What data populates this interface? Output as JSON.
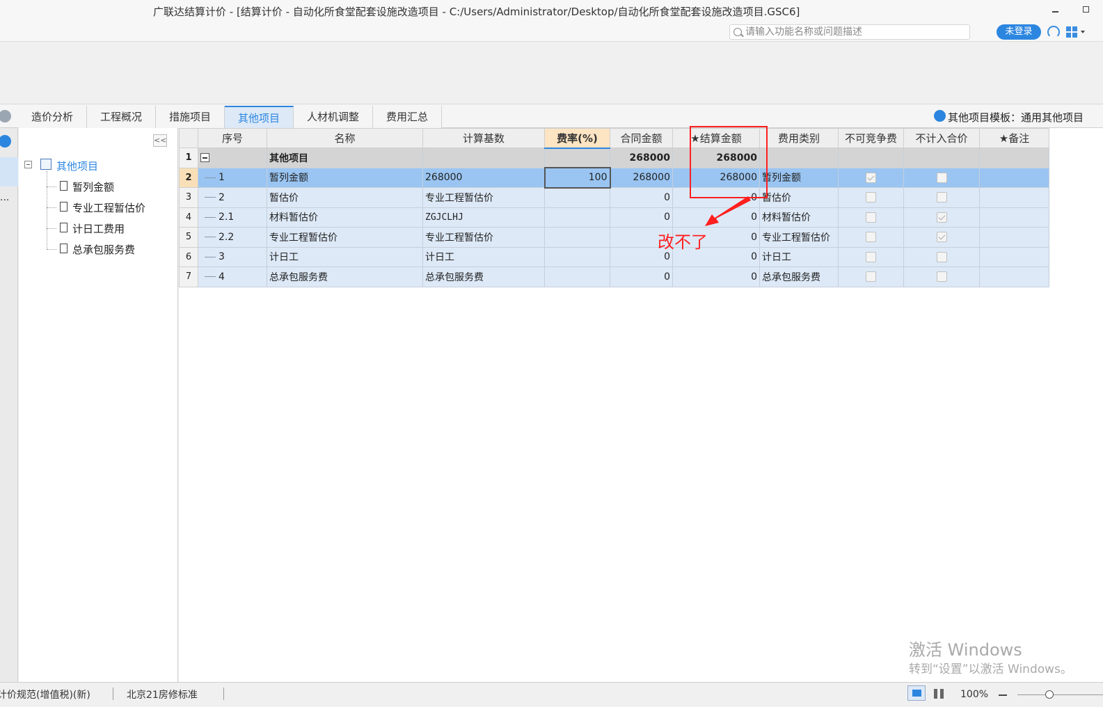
{
  "window": {
    "title": "广联达结算计价 - [结算计价 - 自动化所食堂配套设施改造项目 - C:/Users/Administrator/Desktop/自动化所食堂配套设施改造项目.GSC6]"
  },
  "topbar": {
    "search_placeholder": "请输入功能名称或问题描述",
    "login_label": "未登录"
  },
  "tabs": [
    {
      "label": "造价分析"
    },
    {
      "label": "工程概况"
    },
    {
      "label": "措施项目"
    },
    {
      "label": "其他项目",
      "active": true
    },
    {
      "label": "人材机调整"
    },
    {
      "label": "费用汇总"
    }
  ],
  "template_label": "其他项目模板：通用其他项目",
  "left_strip": {
    "ellipsis": "..."
  },
  "tree": {
    "root": "其他项目",
    "children": [
      "暂列金额",
      "专业工程暂估价",
      "计日工费用",
      "总承包服务费"
    ]
  },
  "grid": {
    "columns": [
      "",
      "序号",
      "名称",
      "计算基数",
      "费率(%)",
      "合同金额",
      "★结算金额",
      "费用类别",
      "不可竞争费",
      "不计入合价",
      "★备注"
    ],
    "rows": [
      {
        "rownum": "1",
        "seq": "",
        "name": "其他项目",
        "base": "",
        "rate": "",
        "contract": "268000",
        "settle": "268000",
        "category": "",
        "noncomp": null,
        "exclude": null,
        "note": ""
      },
      {
        "rownum": "2",
        "seq": "1",
        "name": "暂列金额",
        "base": "268000",
        "rate": "100",
        "contract": "268000",
        "settle": "268000",
        "category": "暂列金额",
        "noncomp": true,
        "exclude": false,
        "note": ""
      },
      {
        "rownum": "3",
        "seq": "2",
        "name": "暂估价",
        "base": "专业工程暂估价",
        "rate": "",
        "contract": "0",
        "settle": "0",
        "category": "暂估价",
        "noncomp": false,
        "exclude": false,
        "note": ""
      },
      {
        "rownum": "4",
        "seq": "2.1",
        "name": "材料暂估价",
        "base": "ZGJCLHJ",
        "rate": "",
        "contract": "0",
        "settle": "0",
        "category": "材料暂估价",
        "noncomp": false,
        "exclude": true,
        "note": ""
      },
      {
        "rownum": "5",
        "seq": "2.2",
        "name": "专业工程暂估价",
        "base": "专业工程暂估价",
        "rate": "",
        "contract": "",
        "settle": "0",
        "category": "专业工程暂估价",
        "noncomp": false,
        "exclude": true,
        "note": ""
      },
      {
        "rownum": "6",
        "seq": "3",
        "name": "计日工",
        "base": "计日工",
        "rate": "",
        "contract": "0",
        "settle": "0",
        "category": "计日工",
        "noncomp": false,
        "exclude": false,
        "note": ""
      },
      {
        "rownum": "7",
        "seq": "4",
        "name": "总承包服务费",
        "base": "总承包服务费",
        "rate": "",
        "contract": "0",
        "settle": "0",
        "category": "总承包服务费",
        "noncomp": false,
        "exclude": false,
        "note": ""
      }
    ]
  },
  "annotation": {
    "text": "改不了",
    "color": "#ff1f1f"
  },
  "watermark": {
    "title": "激活 Windows",
    "subtitle": "转到“设置”以激活 Windows。"
  },
  "statusbar": {
    "items": [
      "计价规范(增值税)(新)",
      "北京21房修标准"
    ],
    "zoom": "100%"
  },
  "colors": {
    "accent": "#2c86e0",
    "row_bg": "#dde9f7",
    "selected_row_bg": "#9ac5f2",
    "group_row_bg": "#d4d4d4"
  }
}
